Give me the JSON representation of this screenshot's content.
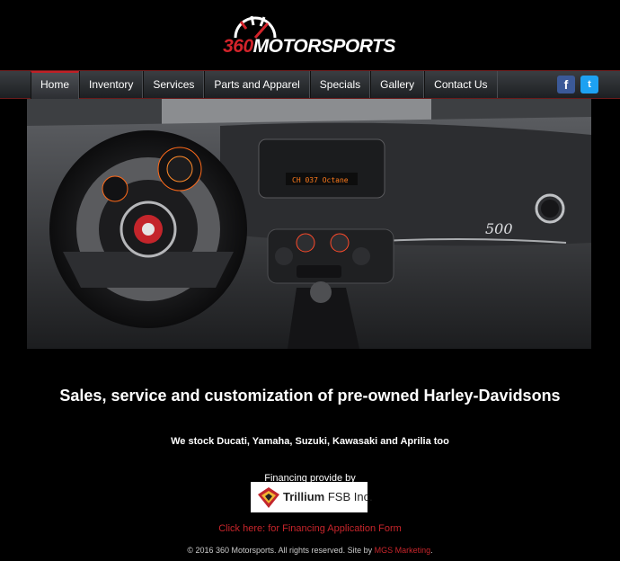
{
  "logo": {
    "num": "360",
    "word": "MOTORSPORTS"
  },
  "nav": {
    "items": [
      {
        "label": "Home"
      },
      {
        "label": "Inventory"
      },
      {
        "label": "Services"
      },
      {
        "label": "Parts and Apparel"
      },
      {
        "label": "Specials"
      },
      {
        "label": "Gallery"
      },
      {
        "label": "Contact Us"
      }
    ],
    "active_index": 0,
    "social": {
      "facebook_glyph": "f",
      "twitter_glyph": "t",
      "facebook_color": "#3b5998",
      "twitter_color": "#1da1f2"
    }
  },
  "hero": {
    "radio_display": "CH 037 Octane",
    "badge": "500"
  },
  "main": {
    "tagline": "Sales, service and customization of pre-owned Harley-Davidsons",
    "stock": "We stock Ducati, Yamaha, Suzuki, Kawasaki and Aprilia too",
    "financing_label": "Financing provide by",
    "lender_name": "Trillium",
    "lender_suffix": " FSB Inc.",
    "financing_link": "Click here: for Financing Application Form"
  },
  "footer": {
    "text": "© 2016 360 Motorsports. All rights reserved. Site by ",
    "credit": "MGS Marketing",
    "end": "."
  },
  "colors": {
    "accent": "#c8252b",
    "background": "#000000"
  }
}
